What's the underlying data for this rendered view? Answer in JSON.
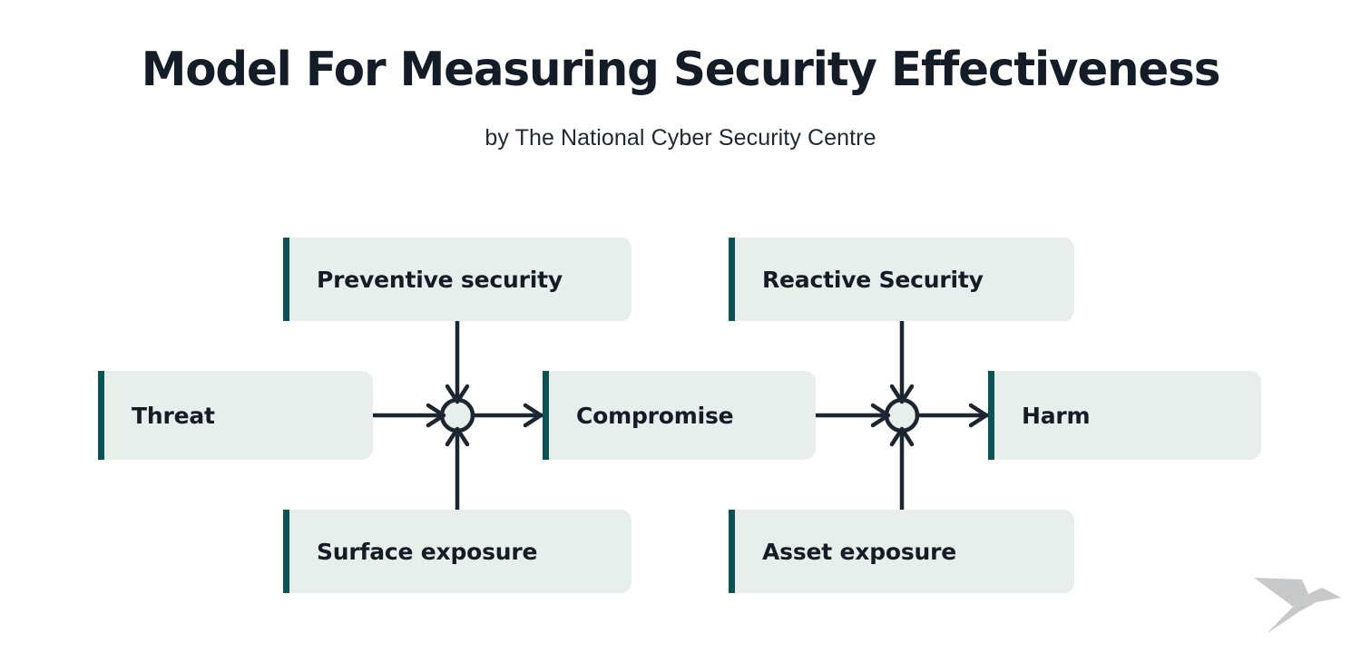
{
  "header": {
    "title": "Model For Measuring Security Effectiveness",
    "subtitle": "by The National Cyber Security Centre"
  },
  "diagram": {
    "nodes": {
      "preventive": "Preventive security",
      "reactive": "Reactive Security",
      "threat": "Threat",
      "compromise": "Compromise",
      "harm": "Harm",
      "surface": "Surface exposure",
      "asset": "Asset exposure"
    },
    "junctions": [
      {
        "id": "junction-1",
        "inputs": [
          "Threat",
          "Preventive security",
          "Surface exposure"
        ],
        "output": "Compromise"
      },
      {
        "id": "junction-2",
        "inputs": [
          "Compromise",
          "Reactive Security",
          "Asset exposure"
        ],
        "output": "Harm"
      }
    ],
    "flow": "Threat → Compromise → Harm"
  },
  "logo": {
    "name": "origami-bird-logo"
  },
  "colors": {
    "background": "#ffffff",
    "node_fill": "#e7eeec",
    "node_accent": "#0b5355",
    "text_dark": "#141d27",
    "connector": "#1b2630",
    "logo_gray": "#c7c8c9"
  }
}
